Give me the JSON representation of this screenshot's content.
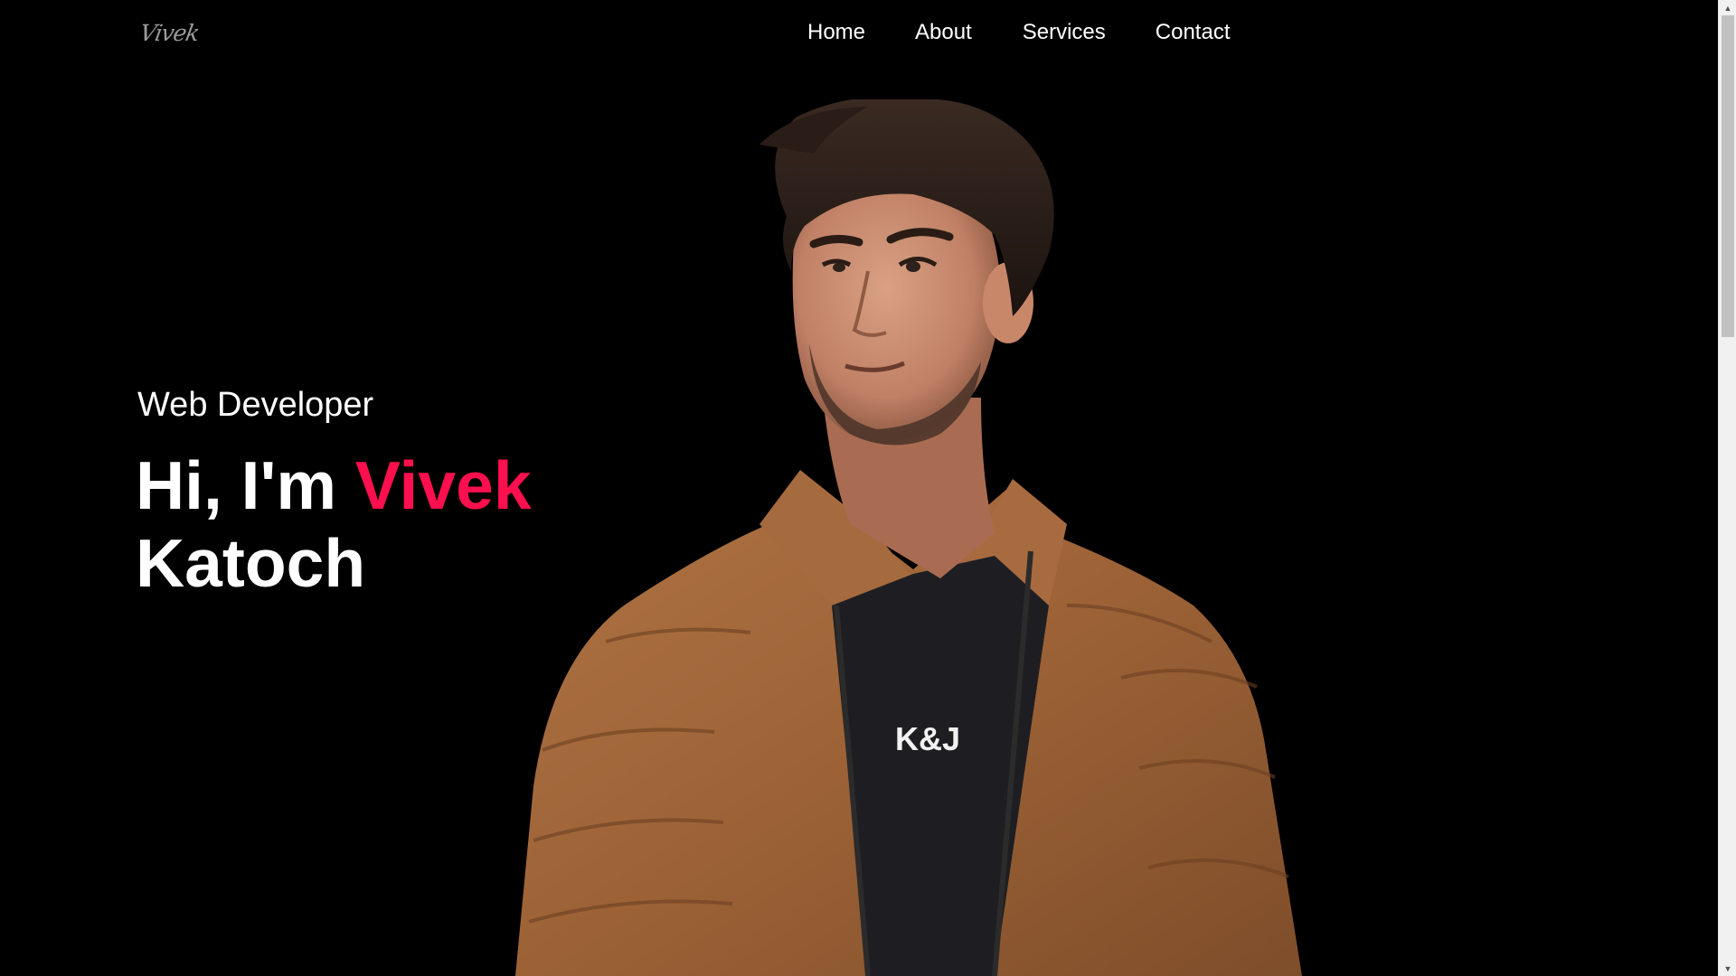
{
  "brand": {
    "logo_text": "Vivek"
  },
  "nav": {
    "items": [
      {
        "label": "Home"
      },
      {
        "label": "About"
      },
      {
        "label": "Services"
      },
      {
        "label": "Contact"
      }
    ]
  },
  "hero": {
    "role": "Web Developer",
    "greeting": "Hi, I'm",
    "first_name": "Vivek",
    "last_name": "Katoch",
    "shirt_text": "K&J"
  },
  "colors": {
    "background": "#000000",
    "accent": "#fe0f4d",
    "text": "#ffffff",
    "jacket": "#a0643a"
  },
  "scrollbar": {
    "position_fraction": 0.0,
    "visible_fraction": 0.34
  }
}
